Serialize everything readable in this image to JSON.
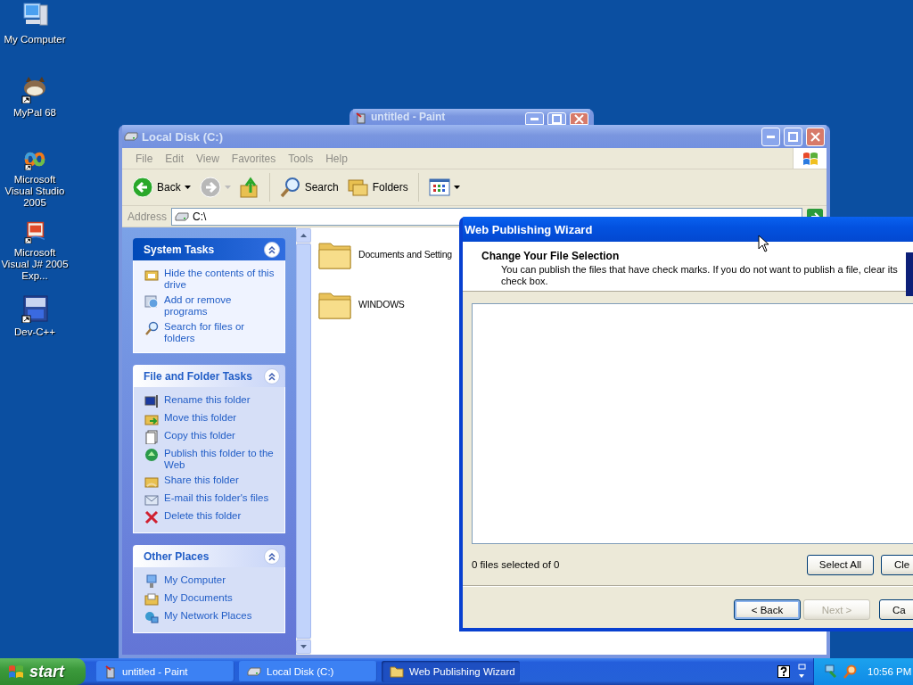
{
  "desktop_icons": [
    {
      "label": "My Computer"
    },
    {
      "label": "MyPal 68"
    },
    {
      "label": "Microsoft Visual Studio 2005"
    },
    {
      "label": "Microsoft Visual J# 2005 Exp..."
    },
    {
      "label": "Dev-C++"
    }
  ],
  "paint_window": {
    "title": "untitled - Paint",
    "active": false
  },
  "explorer": {
    "title": "Local Disk (C:)",
    "active": false,
    "menu": [
      "File",
      "Edit",
      "View",
      "Favorites",
      "Tools",
      "Help"
    ],
    "toolbar": [
      {
        "kind": "back",
        "label": "Back",
        "disabled": false
      },
      {
        "kind": "forward",
        "disabled": true
      },
      {
        "kind": "up",
        "disabled": false
      },
      {
        "kind": "search",
        "label": "Search",
        "disabled": false
      },
      {
        "kind": "folders",
        "label": "Folders",
        "disabled": false
      },
      {
        "kind": "views",
        "disabled": false
      }
    ],
    "address": {
      "label": "Address",
      "value": "C:\\"
    },
    "task_panels": [
      {
        "title": "System Tasks",
        "kind": "special",
        "expanded": true,
        "items": [
          "Hide the contents of this drive",
          "Add or remove programs",
          "Search for files or folders"
        ]
      },
      {
        "title": "File and Folder Tasks",
        "kind": "normal",
        "expanded": true,
        "items": [
          "Rename this folder",
          "Move this folder",
          "Copy this folder",
          "Publish this folder to the Web",
          "Share this folder",
          "E-mail this folder's files",
          "Delete this folder"
        ]
      },
      {
        "title": "Other Places",
        "kind": "normal",
        "expanded": true,
        "items": [
          "My Computer",
          "My Documents",
          "My Network Places"
        ]
      }
    ],
    "files": [
      {
        "name": "Documents and Setting"
      },
      {
        "name": "WINDOWS"
      }
    ]
  },
  "wizard": {
    "title": "Web Publishing Wizard",
    "active": true,
    "heading": "Change Your File Selection",
    "description": "You can publish the files that have check marks.  If you do not want to publish a file, clear its check box.",
    "status": "0 files selected of 0",
    "list_buttons": [
      {
        "label": "Select All"
      },
      {
        "label": "Cle"
      }
    ],
    "nav_buttons": [
      {
        "label": "< Back",
        "disabled": false,
        "default": true
      },
      {
        "label": "Next >",
        "disabled": true,
        "default": false
      },
      {
        "label": "Ca",
        "disabled": false,
        "default": false
      }
    ]
  },
  "taskbar": {
    "start": "start",
    "tasks": [
      {
        "label": "untitled - Paint",
        "selected": false
      },
      {
        "label": "Local Disk (C:)",
        "selected": false
      },
      {
        "label": "Web Publishing Wizard",
        "selected": true
      }
    ],
    "clock": "10:56 PM"
  }
}
